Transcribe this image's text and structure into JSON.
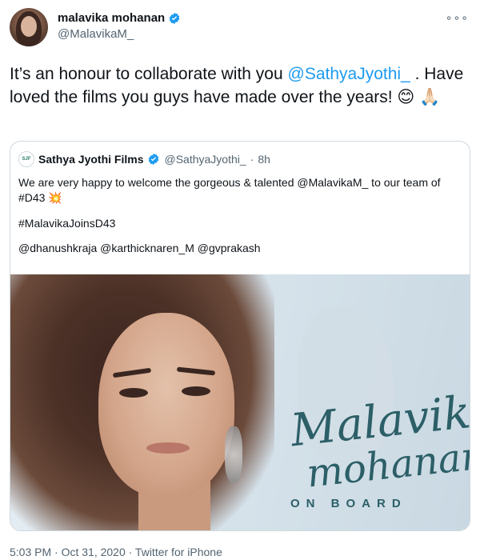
{
  "author": {
    "display_name": "malavika mohanan",
    "handle": "@MalavikaM_",
    "verified": true,
    "more_icon": "more-icon"
  },
  "tweet": {
    "text_before": "It’s an honour to collaborate with you ",
    "mention": "@SathyaJyothi_",
    "text_after": " . Have loved the films you guys have made over the years! ",
    "emoji_1": "😊",
    "emoji_2": "🙏🏻"
  },
  "quoted_tweet": {
    "logo_text": "SJF",
    "display_name": "Sathya Jyothi Films",
    "verified": true,
    "handle": "@SathyaJyothi_",
    "separator": "·",
    "time": "8h",
    "line1_before": "We are very happy to welcome the gorgeous & talented ",
    "line1_mention": "@MalavikaM_",
    "line1_after": "  to our team of #D43 ",
    "line1_emoji": "💥",
    "hashtag_line": "#MalavikaJoinsD43",
    "mentions_line": "@dhanushkraja  @karthicknaren_M @gvprakash",
    "image": {
      "script_line1": "Malavika",
      "script_line2": "mohanan",
      "tagline": "ON BOARD"
    }
  },
  "footer": {
    "meta": "5:03 PM · Oct 31, 2020 · Twitter for iPhone"
  },
  "colors": {
    "link": "#1d9bf0",
    "verified": "#1d9bf0",
    "text": "#0f1419",
    "muted": "#536471",
    "accent_teal": "#2c5f67"
  }
}
